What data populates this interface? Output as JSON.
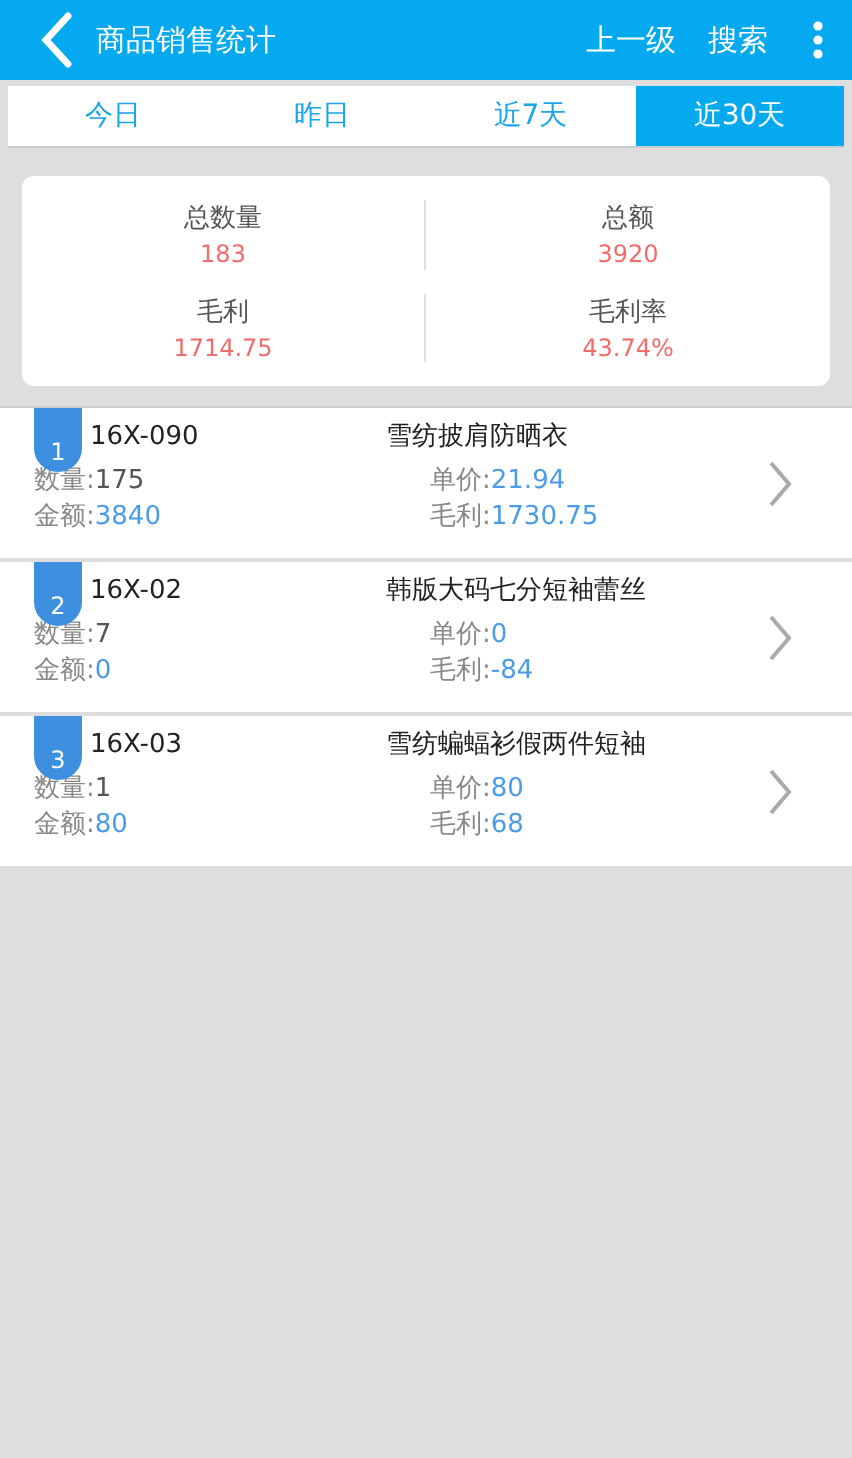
{
  "header": {
    "title": "商品销售统计",
    "actions": [
      "上一级",
      "搜索"
    ]
  },
  "tabs": [
    {
      "label": "今日",
      "selected": false
    },
    {
      "label": "昨日",
      "selected": false
    },
    {
      "label": "近7天",
      "selected": false
    },
    {
      "label": "近30天",
      "selected": true
    }
  ],
  "summary": [
    {
      "label": "总数量",
      "value": "183"
    },
    {
      "label": "总额",
      "value": "3920"
    },
    {
      "label": "毛利",
      "value": "1714.75"
    },
    {
      "label": "毛利率",
      "value": "43.74%"
    }
  ],
  "products": [
    {
      "rank": "1",
      "code": "16X-090",
      "name": "雪纺披肩防晒衣",
      "fields": [
        {
          "kind": "plain",
          "label": "数量:",
          "value": "175"
        },
        {
          "kind": "money",
          "label": "单价:",
          "value": "21.94"
        },
        {
          "kind": "money",
          "label": "金额:",
          "value": "3840"
        },
        {
          "kind": "money",
          "label": "毛利:",
          "value": "1730.75"
        }
      ]
    },
    {
      "rank": "2",
      "code": "16X-02",
      "name": "韩版大码七分短袖蕾丝",
      "fields": [
        {
          "kind": "plain",
          "label": "数量:",
          "value": "7"
        },
        {
          "kind": "money",
          "label": "单价:",
          "value": "0"
        },
        {
          "kind": "money",
          "label": "金额:",
          "value": "0"
        },
        {
          "kind": "money",
          "label": "毛利:",
          "value": "-84"
        }
      ]
    },
    {
      "rank": "3",
      "code": "16X-03",
      "name": "雪纺蝙蝠衫假两件短袖",
      "fields": [
        {
          "kind": "plain",
          "label": "数量:",
          "value": "1"
        },
        {
          "kind": "money",
          "label": "单价:",
          "value": "80"
        },
        {
          "kind": "money",
          "label": "金额:",
          "value": "80"
        },
        {
          "kind": "money",
          "label": "毛利:",
          "value": "68"
        }
      ]
    }
  ]
}
